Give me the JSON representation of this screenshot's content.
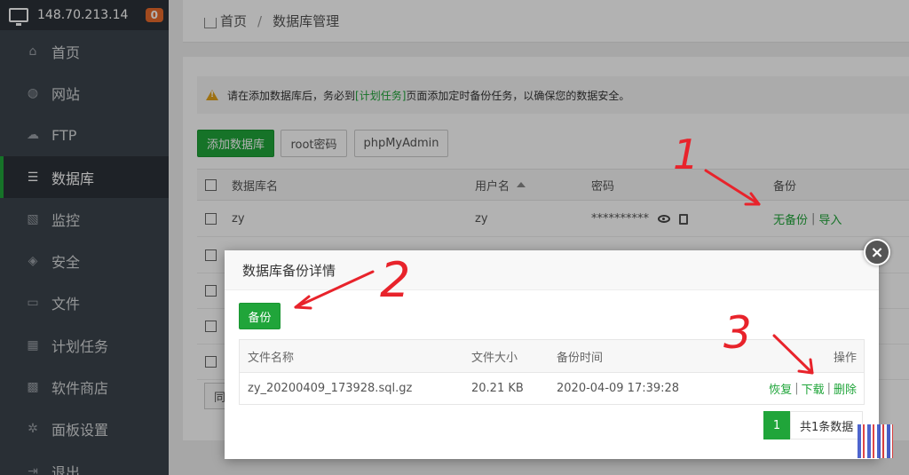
{
  "server": {
    "ip": "148.70.213.14",
    "badge": "0"
  },
  "sidebar": {
    "items": [
      {
        "label": "首页",
        "icon": "home-icon",
        "icon_glyph": "⌂"
      },
      {
        "label": "网站",
        "icon": "globe-icon",
        "icon_glyph": "◍"
      },
      {
        "label": "FTP",
        "icon": "ftp-icon",
        "icon_glyph": "☁"
      },
      {
        "label": "数据库",
        "icon": "database-icon",
        "icon_glyph": "☰"
      },
      {
        "label": "监控",
        "icon": "monitor-icon",
        "icon_glyph": "▧"
      },
      {
        "label": "安全",
        "icon": "shield-icon",
        "icon_glyph": "◈"
      },
      {
        "label": "文件",
        "icon": "folder-icon",
        "icon_glyph": "▭"
      },
      {
        "label": "计划任务",
        "icon": "calendar-icon",
        "icon_glyph": "▦"
      },
      {
        "label": "软件商店",
        "icon": "apps-icon",
        "icon_glyph": "▩"
      },
      {
        "label": "面板设置",
        "icon": "gear-icon",
        "icon_glyph": "✲"
      },
      {
        "label": "退出",
        "icon": "logout-icon",
        "icon_glyph": "⇥"
      }
    ],
    "active_index": 3
  },
  "breadcrumb": {
    "home": "首页",
    "sep": "/",
    "current": "数据库管理"
  },
  "tip": {
    "before": "请在添加数据库后，务必到",
    "link": "[计划任务]",
    "after": "页面添加定时备份任务，以确保您的数据安全。"
  },
  "toolbar": {
    "add": "添加数据库",
    "root": "root密码",
    "pma": "phpMyAdmin"
  },
  "table": {
    "headers": {
      "name": "数据库名",
      "user": "用户名",
      "password": "密码",
      "backup": "备份"
    },
    "row": {
      "name": "zy",
      "user": "zy",
      "password": "**********",
      "no_backup": "无备份",
      "sep": "|",
      "import": "导入"
    }
  },
  "pager_fragment": "同",
  "dialog": {
    "title": "数据库备份详情",
    "close": "×",
    "backup_button": "备份",
    "headers": {
      "file": "文件名称",
      "size": "文件大小",
      "time": "备份时间",
      "ops": "操作"
    },
    "row": {
      "file": "zy_20200409_173928.sql.gz",
      "size": "20.21 KB",
      "time": "2020-04-09 17:39:28",
      "restore": "恢复",
      "download": "下载",
      "delete": "删除",
      "sep": "|"
    },
    "pager": {
      "current": "1",
      "info": "共1条数据"
    }
  },
  "annotations": [
    "1",
    "2",
    "3"
  ],
  "colors": {
    "accent": "#20a53a",
    "sidebar": "#3c444d",
    "annotation": "#e8232b",
    "badge": "#e96a2b"
  }
}
